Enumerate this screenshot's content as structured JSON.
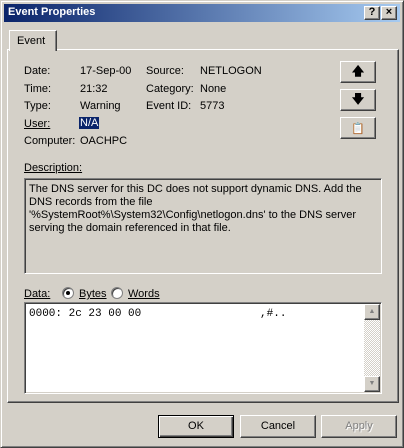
{
  "window": {
    "title": "Event Properties"
  },
  "titlebar": {
    "help_glyph": "?",
    "close_glyph": "×"
  },
  "tabs": [
    {
      "label": "Event"
    }
  ],
  "fields": {
    "date_label": "Date:",
    "date_value": "17-Sep-00",
    "time_label": "Time:",
    "time_value": "21:32",
    "type_label": "Type:",
    "type_value": "Warning",
    "user_label": "User:",
    "user_value": "N/A",
    "computer_label": "Computer:",
    "computer_value": "OACHPC",
    "source_label": "Source:",
    "source_value": "NETLOGON",
    "category_label": "Category:",
    "category_value": "None",
    "eventid_label": "Event ID:",
    "eventid_value": "5773"
  },
  "nav": {
    "up_glyph": "🡅",
    "down_glyph": "🡇",
    "copy_glyph": "📋"
  },
  "description": {
    "label": "Description:",
    "text": "The DNS server for this DC does not support dynamic DNS. Add the DNS records from the file '%SystemRoot%\\System32\\Config\\netlogon.dns' to the DNS server serving the domain referenced in that file."
  },
  "data": {
    "label": "Data:",
    "options": [
      "Bytes",
      "Words"
    ],
    "selected": "Bytes",
    "lines": [
      "0000: 2c 23 00 00                  ,#.."
    ]
  },
  "buttons": {
    "ok": "OK",
    "cancel": "Cancel",
    "apply": "Apply"
  }
}
